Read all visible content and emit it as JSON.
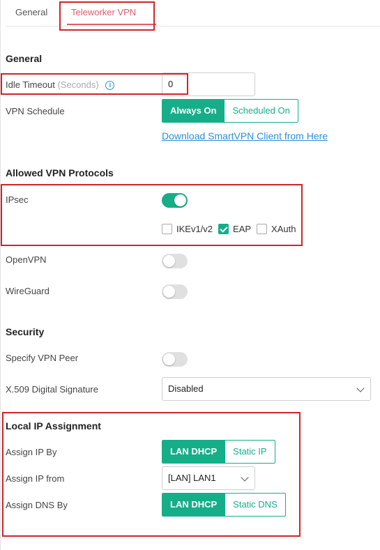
{
  "tabs": {
    "general": "General",
    "teleworker_vpn": "Teleworker VPN"
  },
  "general": {
    "heading": "General",
    "idle_timeout_label": "Idle Timeout",
    "idle_timeout_hint": "(Seconds)",
    "idle_timeout_value": "0",
    "vpn_schedule_label": "VPN Schedule",
    "schedule_options": [
      "Always On",
      "Scheduled On"
    ],
    "schedule_selected": "Always On",
    "download_link": "Download SmartVPN Client from Here"
  },
  "protocols": {
    "heading": "Allowed VPN Protocols",
    "ipsec_label": "IPsec",
    "ipsec_enabled": true,
    "ipsec_options": [
      {
        "label": "IKEv1/v2",
        "checked": false
      },
      {
        "label": "EAP",
        "checked": true
      },
      {
        "label": "XAuth",
        "checked": false
      }
    ],
    "openvpn_label": "OpenVPN",
    "openvpn_enabled": false,
    "wireguard_label": "WireGuard",
    "wireguard_enabled": false
  },
  "security": {
    "heading": "Security",
    "peer_label": "Specify VPN Peer",
    "peer_enabled": false,
    "x509_label": "X.509 Digital Signature",
    "x509_value": "Disabled"
  },
  "local_ip": {
    "heading": "Local IP Assignment",
    "assign_by_label": "Assign IP By",
    "assign_by_options": [
      "LAN DHCP",
      "Static IP"
    ],
    "assign_by_selected": "LAN DHCP",
    "assign_from_label": "Assign IP from",
    "assign_from_value": "[LAN] LAN1",
    "dns_by_label": "Assign DNS By",
    "dns_by_options": [
      "LAN DHCP",
      "Static DNS"
    ],
    "dns_by_selected": "LAN DHCP"
  },
  "colors": {
    "accent": "#15ae88",
    "tab_active": "#e05a6d",
    "link": "#2a8fd8",
    "highlight": "#d1232a"
  }
}
